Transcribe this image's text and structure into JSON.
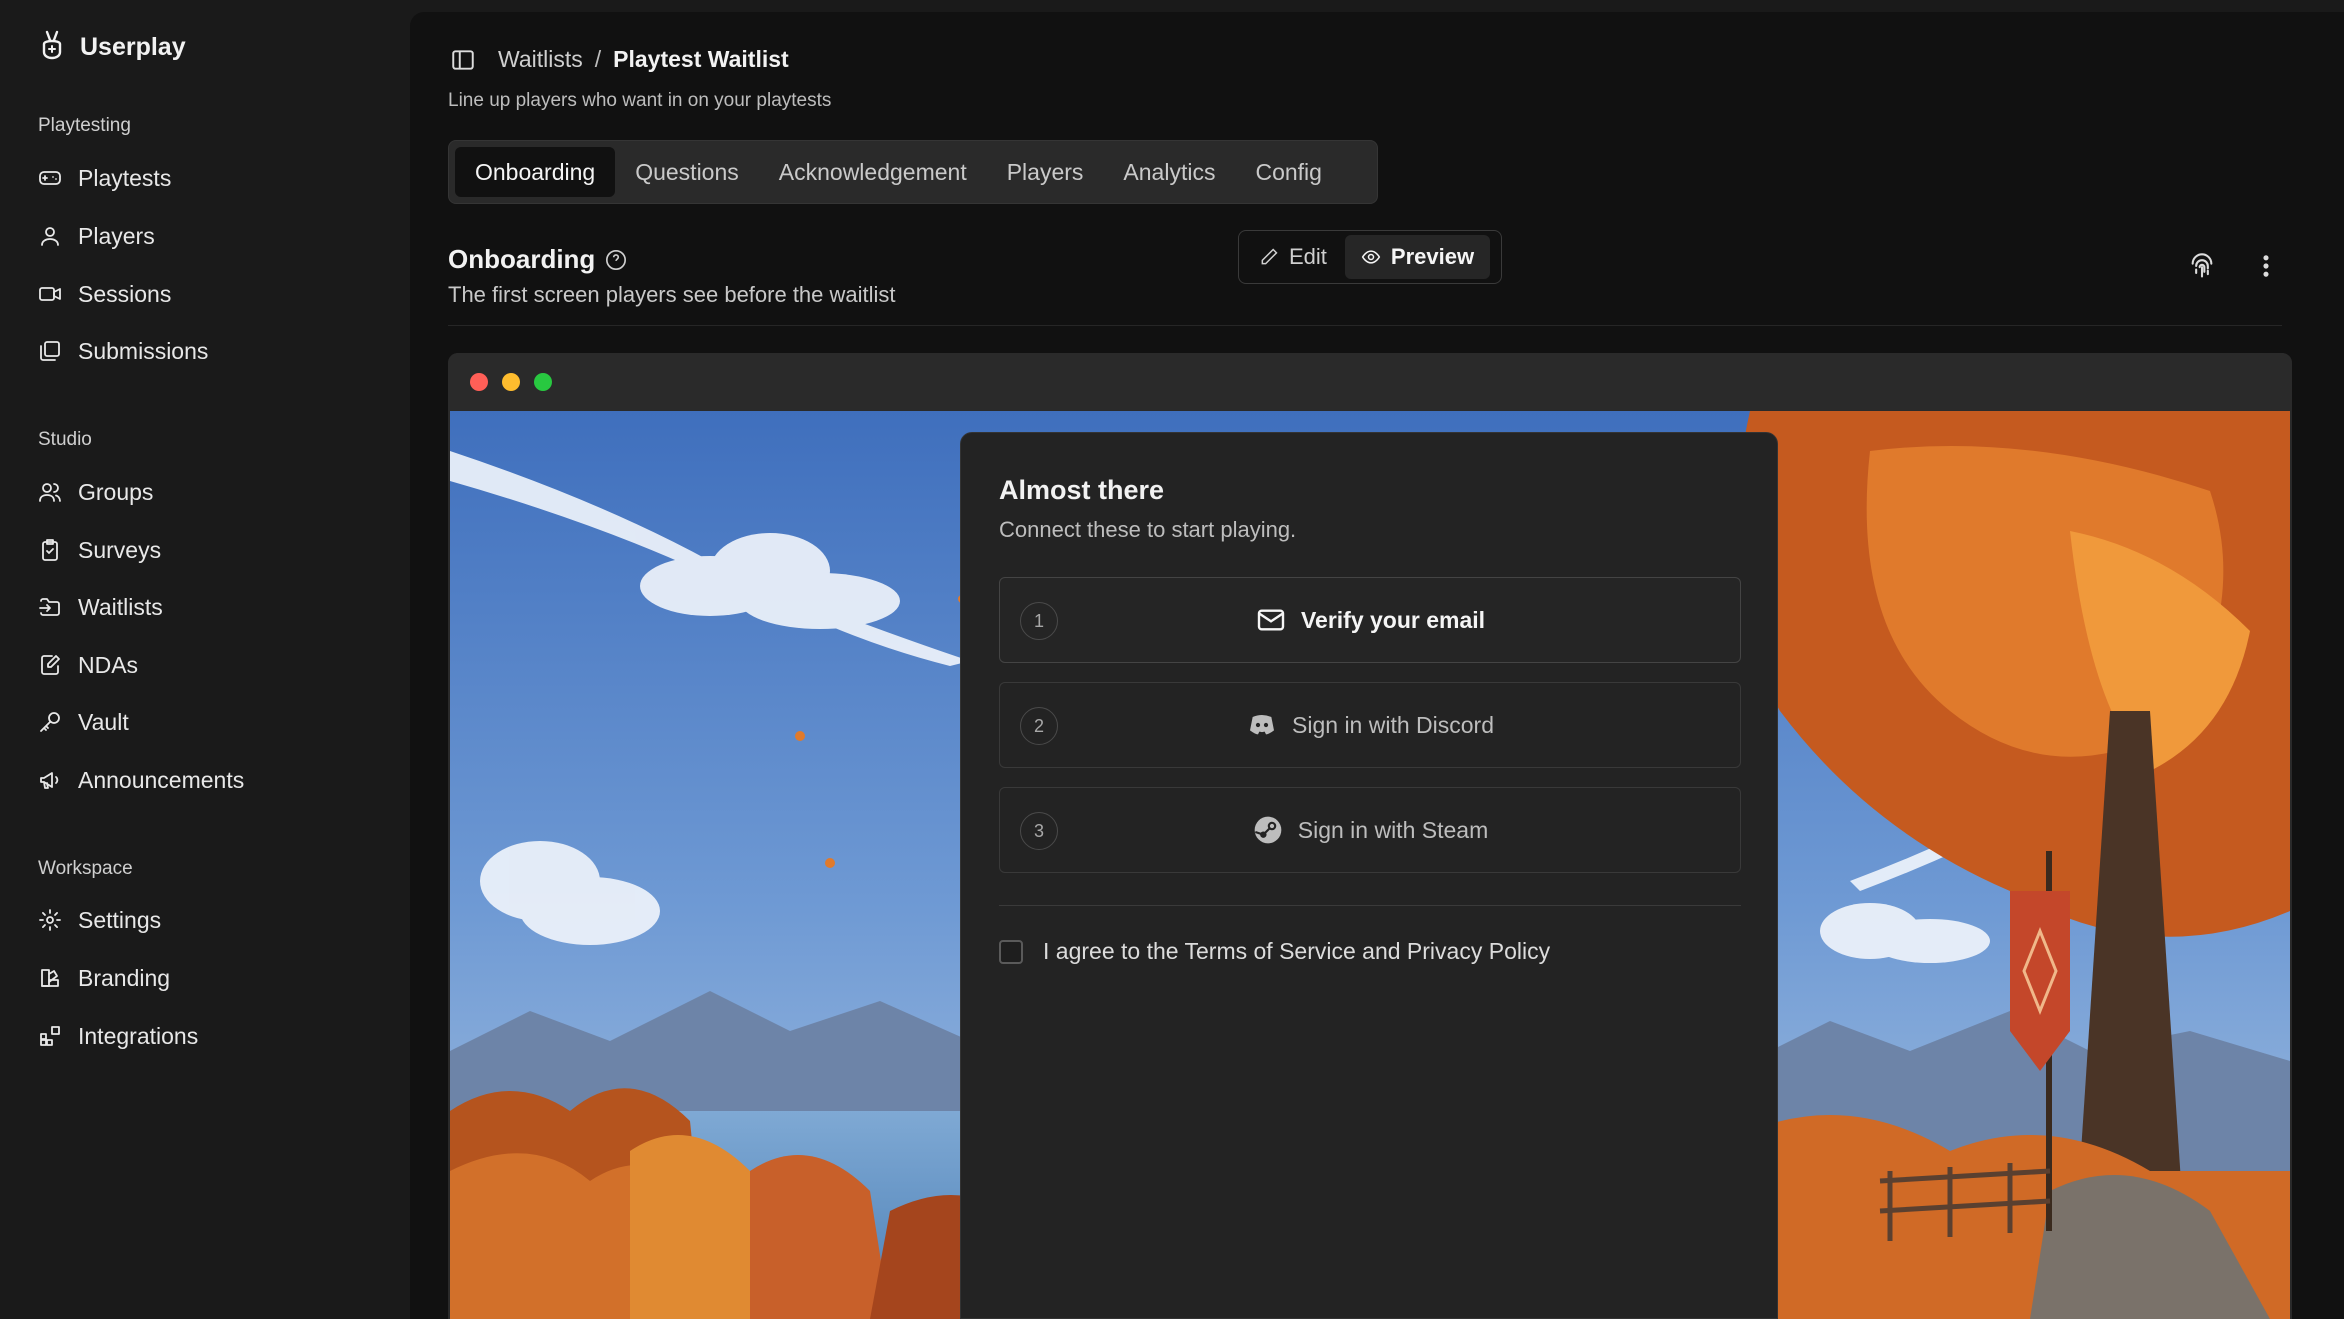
{
  "app": {
    "name": "Userplay"
  },
  "sidebar": {
    "sections": [
      {
        "title": "Playtesting",
        "items": [
          "Playtests",
          "Players",
          "Sessions",
          "Submissions"
        ]
      },
      {
        "title": "Studio",
        "items": [
          "Groups",
          "Surveys",
          "Waitlists",
          "NDAs",
          "Vault",
          "Announcements"
        ]
      },
      {
        "title": "Workspace",
        "items": [
          "Settings",
          "Branding",
          "Integrations"
        ]
      }
    ]
  },
  "header": {
    "breadcrumb_parent": "Waitlists",
    "breadcrumb_sep": "/",
    "breadcrumb_current": "Playtest Waitlist",
    "subtitle": "Line up players who want in on your playtests"
  },
  "tabs": [
    "Onboarding",
    "Questions",
    "Acknowledgement",
    "Players",
    "Analytics",
    "Config"
  ],
  "active_tab": "Onboarding",
  "section": {
    "title": "Onboarding",
    "description": "The first screen players see before the waitlist"
  },
  "mode_toggle": {
    "edit": "Edit",
    "preview": "Preview",
    "active": "Preview"
  },
  "preview": {
    "card_title": "Almost there",
    "card_subtitle": "Connect these to start playing.",
    "steps": [
      {
        "num": "1",
        "label": "Verify your email",
        "icon": "mail-icon"
      },
      {
        "num": "2",
        "label": "Sign in with Discord",
        "icon": "discord-icon"
      },
      {
        "num": "3",
        "label": "Sign in with Steam",
        "icon": "steam-icon"
      }
    ],
    "agree_text": "I agree to the Terms of Service and Privacy Policy",
    "agree_checked": false
  },
  "colors": {
    "window_red": "#ff5f57",
    "window_yellow": "#febc2e",
    "window_green": "#28c840"
  }
}
